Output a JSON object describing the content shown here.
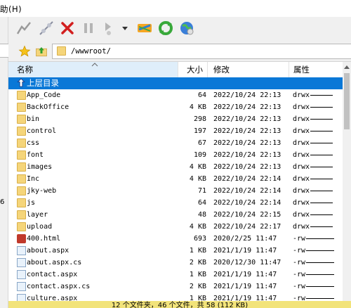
{
  "menu": {
    "help_label": "助(H)"
  },
  "toolbar": {
    "buttons": [
      "connect-icon",
      "disconnect-icon",
      "stop-icon",
      "pause-icon",
      "resume-icon",
      "transfer-icon",
      "refresh-icon",
      "globe-icon"
    ]
  },
  "address": {
    "path": "/wwwroot/"
  },
  "left_panel": {
    "digit": "6"
  },
  "columns": {
    "name": "名称",
    "size": "大小",
    "modified": "修改",
    "attr": "属性"
  },
  "parent_row": {
    "label": "上层目录"
  },
  "files": [
    {
      "name": "App_Code",
      "size": "64",
      "date": "2022/10/24 22:13",
      "attr": "drwx",
      "type": "folder"
    },
    {
      "name": "BackOffice",
      "size": "4 KB",
      "date": "2022/10/24 22:13",
      "attr": "drwx",
      "type": "folder"
    },
    {
      "name": "bin",
      "size": "298",
      "date": "2022/10/24 22:13",
      "attr": "drwx",
      "type": "folder"
    },
    {
      "name": "control",
      "size": "197",
      "date": "2022/10/24 22:13",
      "attr": "drwx",
      "type": "folder"
    },
    {
      "name": "css",
      "size": "67",
      "date": "2022/10/24 22:13",
      "attr": "drwx",
      "type": "folder"
    },
    {
      "name": "font",
      "size": "109",
      "date": "2022/10/24 22:13",
      "attr": "drwx",
      "type": "folder"
    },
    {
      "name": "images",
      "size": "4 KB",
      "date": "2022/10/24 22:13",
      "attr": "drwx",
      "type": "folder"
    },
    {
      "name": "Inc",
      "size": "4 KB",
      "date": "2022/10/24 22:14",
      "attr": "drwx",
      "type": "folder"
    },
    {
      "name": "jky-web",
      "size": "71",
      "date": "2022/10/24 22:14",
      "attr": "drwx",
      "type": "folder"
    },
    {
      "name": "js",
      "size": "64",
      "date": "2022/10/24 22:14",
      "attr": "drwx",
      "type": "folder"
    },
    {
      "name": "layer",
      "size": "48",
      "date": "2022/10/24 22:15",
      "attr": "drwx",
      "type": "folder"
    },
    {
      "name": "upload",
      "size": "4 KB",
      "date": "2022/10/24 22:17",
      "attr": "drwx",
      "type": "folder"
    },
    {
      "name": "400.html",
      "size": "693",
      "date": "2020/2/25 11:47",
      "attr": "-rw",
      "type": "html"
    },
    {
      "name": "about.aspx",
      "size": "1 KB",
      "date": "2021/1/19 11:47",
      "attr": "-rw",
      "type": "file"
    },
    {
      "name": "about.aspx.cs",
      "size": "2 KB",
      "date": "2020/12/30 11:47",
      "attr": "-rw",
      "type": "file"
    },
    {
      "name": "contact.aspx",
      "size": "1 KB",
      "date": "2021/1/19 11:47",
      "attr": "-rw",
      "type": "file"
    },
    {
      "name": "contact.aspx.cs",
      "size": "2 KB",
      "date": "2021/1/19 11:47",
      "attr": "-rw",
      "type": "file"
    },
    {
      "name": "culture.aspx",
      "size": "1 KB",
      "date": "2021/1/19 11:47",
      "attr": "-rw",
      "type": "file"
    }
  ],
  "status": {
    "text": "12 个文件夹，46 个文件，共 58 (112 KB)"
  }
}
